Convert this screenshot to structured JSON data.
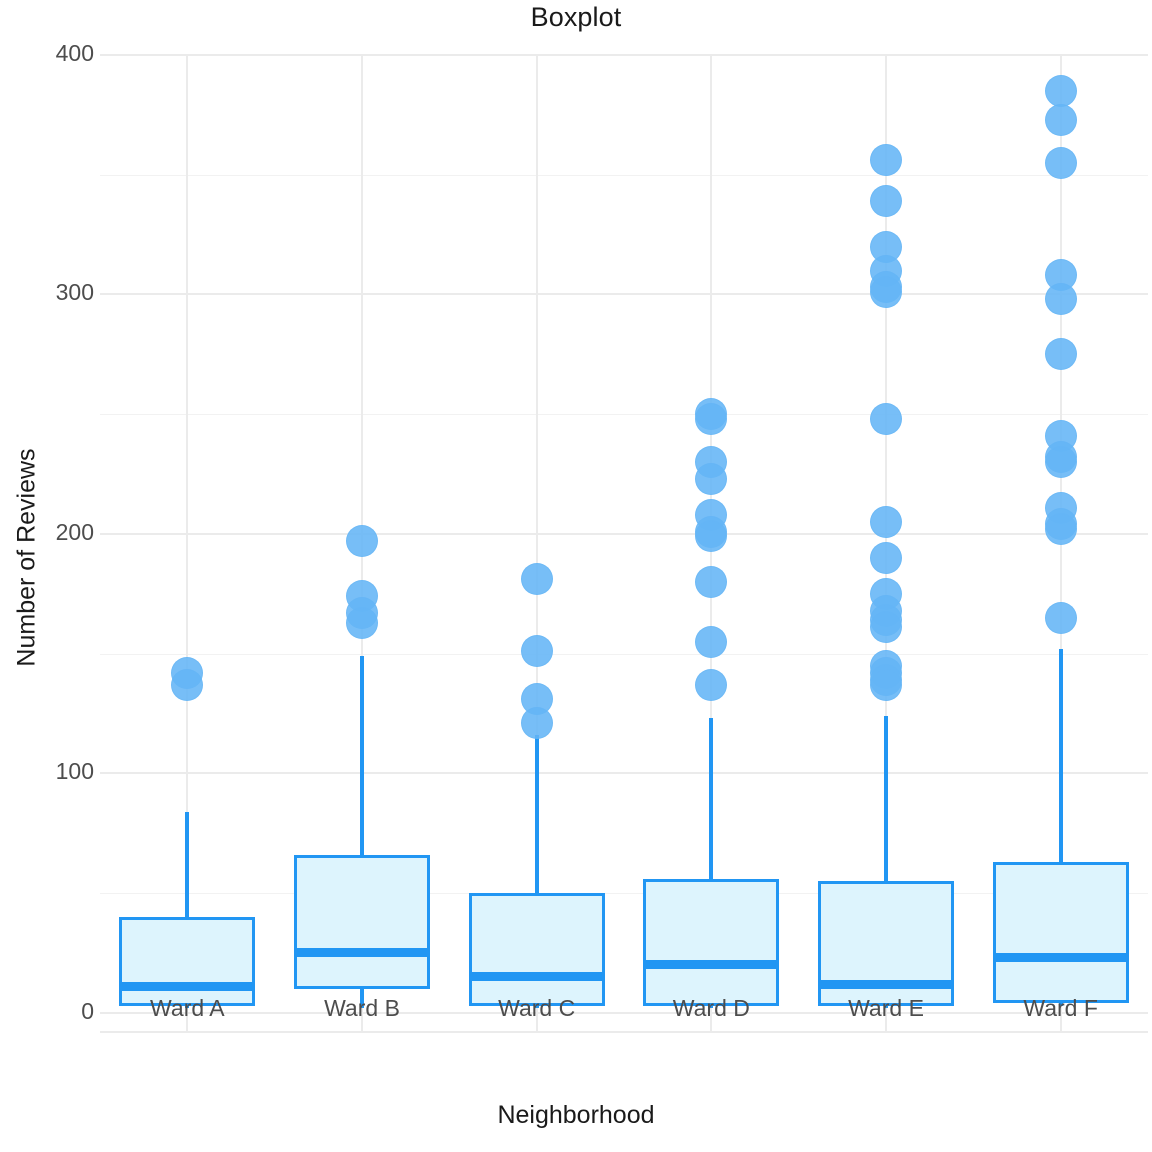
{
  "chart_data": {
    "type": "box",
    "title": "Boxplot",
    "xlabel": "Neighborhood",
    "ylabel": "Number of Reviews",
    "categories": [
      "Ward A",
      "Ward B",
      "Ward C",
      "Ward D",
      "Ward E",
      "Ward F"
    ],
    "ylim": [
      -8,
      400
    ],
    "yticks": [
      0,
      100,
      200,
      300,
      400
    ],
    "ytick_labels": [
      "0",
      "100",
      "200",
      "300",
      "400"
    ],
    "yminor": [
      50,
      150,
      250,
      350
    ],
    "grid": true,
    "legend": "none",
    "colors": {
      "box_fill": "#ddf4fd",
      "box_stroke": "#2196f3",
      "median": "#2196f3",
      "whisker": "#2196f3",
      "outlier": "#64b5f6",
      "gridline_major": "#ebebeb",
      "gridline_minor": "#f2f2f2",
      "panel_background": "#ffffff",
      "text": "#4d4d4d"
    },
    "boxes": [
      {
        "name": "Ward A",
        "lower_whisker": 2,
        "q1": 3,
        "median": 11,
        "q3": 40,
        "upper_whisker": 84,
        "outliers": [
          142,
          137
        ]
      },
      {
        "name": "Ward B",
        "lower_whisker": 2,
        "q1": 10,
        "median": 25,
        "q3": 66,
        "upper_whisker": 149,
        "outliers": [
          197,
          174,
          167,
          163
        ]
      },
      {
        "name": "Ward C",
        "lower_whisker": 2,
        "q1": 3,
        "median": 15,
        "q3": 50,
        "upper_whisker": 116,
        "outliers": [
          181,
          151,
          131,
          121
        ]
      },
      {
        "name": "Ward D",
        "lower_whisker": 2,
        "q1": 3,
        "median": 20,
        "q3": 56,
        "upper_whisker": 123,
        "outliers": [
          250,
          248,
          230,
          223,
          208,
          201,
          199,
          180,
          155,
          137
        ]
      },
      {
        "name": "Ward E",
        "lower_whisker": 2,
        "q1": 3,
        "median": 12,
        "q3": 55,
        "upper_whisker": 124,
        "outliers": [
          356,
          339,
          320,
          310,
          303,
          301,
          248,
          205,
          190,
          175,
          168,
          164,
          161,
          145,
          142,
          139,
          137
        ]
      },
      {
        "name": "Ward F",
        "lower_whisker": 3,
        "q1": 4,
        "median": 23,
        "q3": 63,
        "upper_whisker": 152,
        "outliers": [
          385,
          373,
          355,
          308,
          298,
          275,
          241,
          232,
          230,
          211,
          204,
          202,
          165
        ]
      }
    ]
  }
}
